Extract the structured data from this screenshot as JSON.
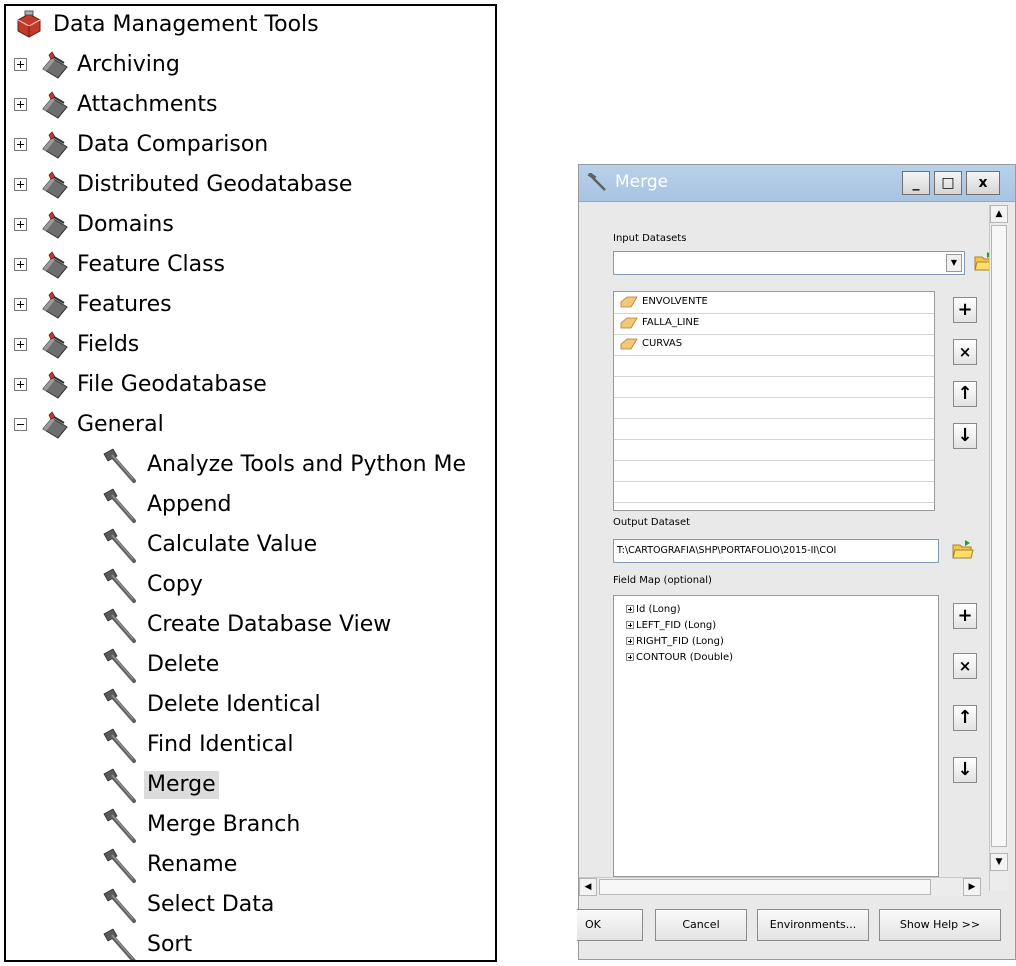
{
  "tree": {
    "root": {
      "label": "Data Management Tools",
      "icon": "toolbox-icon"
    },
    "toolsets": [
      {
        "label": "Archiving",
        "expanded": false
      },
      {
        "label": "Attachments",
        "expanded": false
      },
      {
        "label": "Data Comparison",
        "expanded": false
      },
      {
        "label": "Distributed Geodatabase",
        "expanded": false
      },
      {
        "label": "Domains",
        "expanded": false
      },
      {
        "label": "Feature Class",
        "expanded": false
      },
      {
        "label": "Features",
        "expanded": false
      },
      {
        "label": "Fields",
        "expanded": false
      },
      {
        "label": "File Geodatabase",
        "expanded": false
      },
      {
        "label": "General",
        "expanded": true
      }
    ],
    "tools": [
      {
        "label": "Analyze Tools and Python Me"
      },
      {
        "label": "Append"
      },
      {
        "label": "Calculate Value"
      },
      {
        "label": "Copy"
      },
      {
        "label": "Create Database View"
      },
      {
        "label": "Delete"
      },
      {
        "label": "Delete Identical"
      },
      {
        "label": "Find Identical"
      },
      {
        "label": "Merge",
        "selected": true
      },
      {
        "label": "Merge Branch"
      },
      {
        "label": "Rename"
      },
      {
        "label": "Select Data"
      },
      {
        "label": "Sort"
      }
    ]
  },
  "dialog": {
    "title": "Merge",
    "window_buttons": {
      "minimize": "_",
      "maximize": "□",
      "close": "x"
    },
    "input_label": "Input Datasets",
    "input_value": "",
    "datasets": [
      "ENVOLVENTE",
      "FALLA_LINE",
      "CURVAS"
    ],
    "output_label": "Output Dataset",
    "output_value": "T:\\CARTOGRAFIA\\SHP\\PORTAFOLIO\\2015-II\\COI",
    "fieldmap_label": "Field Map (optional)",
    "fields": [
      "Id (Long)",
      "LEFT_FID (Long)",
      "RIGHT_FID (Long)",
      "CONTOUR (Double)"
    ],
    "side_buttons": {
      "add": "+",
      "remove": "×",
      "up": "↑",
      "down": "↓"
    },
    "buttons": {
      "ok": "OK",
      "cancel": "Cancel",
      "environments": "Environments...",
      "help": "Show Help >>"
    }
  }
}
